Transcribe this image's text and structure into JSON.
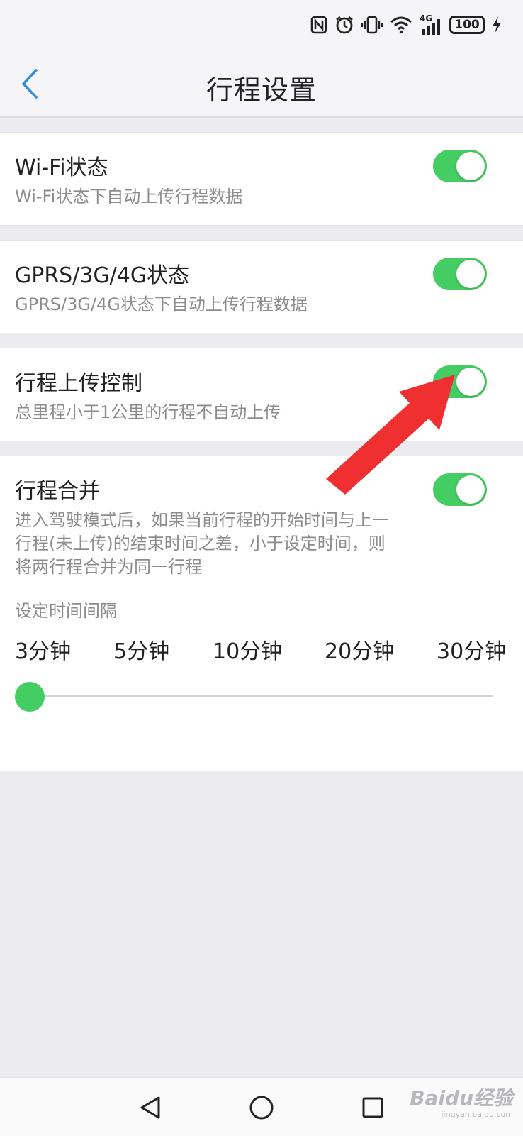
{
  "status_bar": {
    "icons": [
      "nfc-icon",
      "alarm-icon",
      "vibrate-icon",
      "wifi-icon",
      "signal-4g-icon",
      "battery-icon",
      "charging-icon"
    ],
    "network": "4G",
    "battery": "100"
  },
  "header": {
    "title": "行程设置",
    "back_icon": "chevron-left-icon"
  },
  "settings": [
    {
      "title": "Wi-Fi状态",
      "description": "Wi-Fi状态下自动上传行程数据",
      "enabled": true
    },
    {
      "title": "GPRS/3G/4G状态",
      "description": "GPRS/3G/4G状态下自动上传行程数据",
      "enabled": true
    },
    {
      "title": "行程上传控制",
      "description": "总里程小于1公里的行程不自动上传",
      "enabled": true
    },
    {
      "title": "行程合并",
      "description_lines": [
        "进入驾驶模式后，如果当前行程的开始时间与上一",
        "行程(未上传)的结束时间之差，小于设定时间，则",
        "将两行程合并为同一行程"
      ],
      "enabled": true
    }
  ],
  "interval": {
    "label": "设定时间间隔",
    "options": [
      "3分钟",
      "5分钟",
      "10分钟",
      "20分钟",
      "30分钟"
    ],
    "selected_index": 0
  },
  "bottom_nav": {
    "icons": [
      "back-triangle-icon",
      "home-circle-icon",
      "recents-square-icon"
    ]
  },
  "watermark": {
    "text": "Baidu经验",
    "subtext": "jingyan.baidu.com"
  },
  "colors": {
    "accent_green": "#43cd63",
    "back_blue": "#2f8fdc",
    "annotation_red": "#f03030"
  }
}
